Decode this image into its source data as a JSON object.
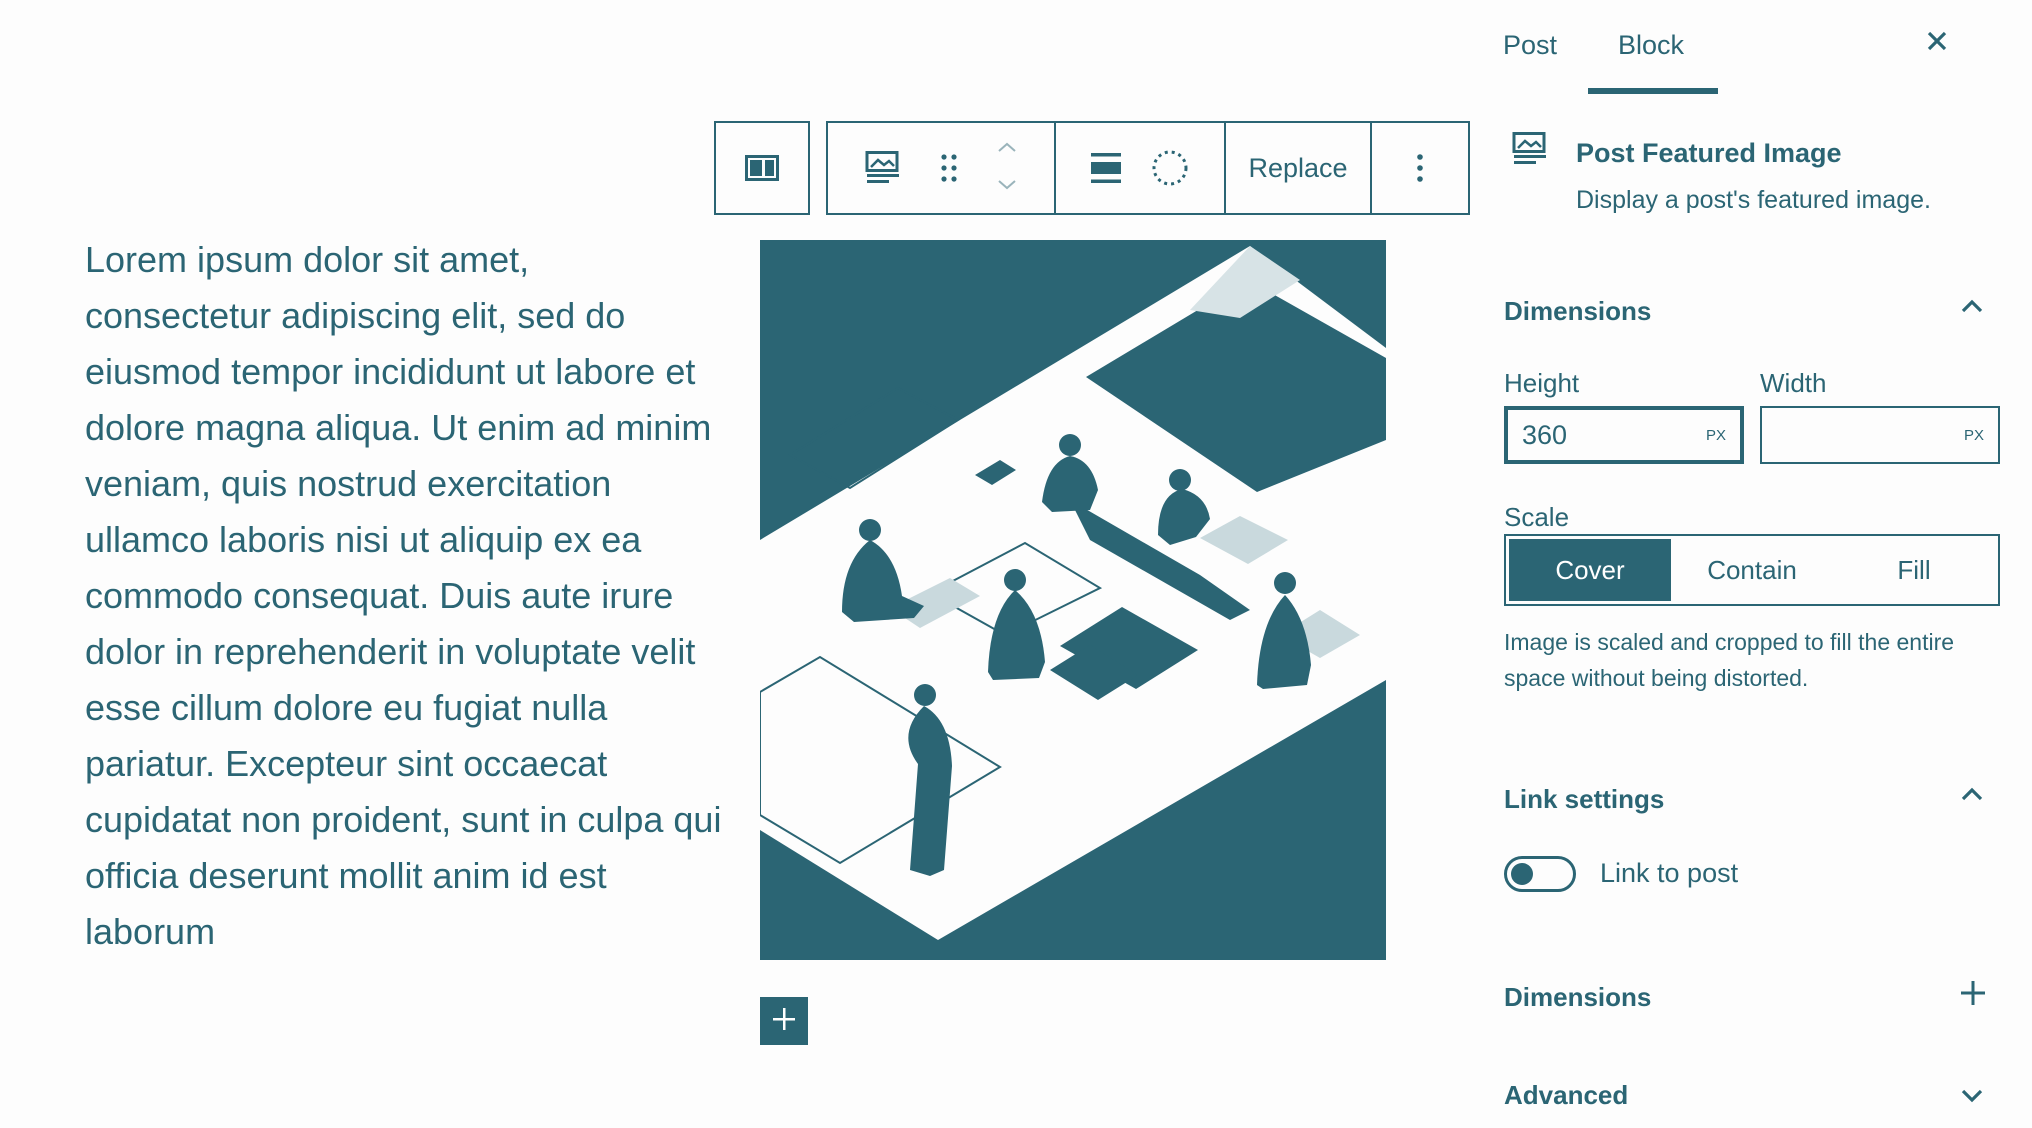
{
  "paragraph": {
    "text": "Lorem ipsum dolor sit amet, consectetur adipiscing elit, sed do eiusmod tempor incididunt ut labore et dolore magna aliqua. Ut enim ad minim veniam, quis nostrud exercitation ullamco laboris nisi ut aliquip ex ea commodo consequat. Duis aute irure dolor in reprehenderit in voluptate velit esse cillum dolore eu fugiat nulla pariatur. Excepteur sint occaecat cupidatat non proident, sunt in culpa qui officia deserunt mollit anim id est laborum"
  },
  "toolbar": {
    "parent_icon": "media-text-icon",
    "block_icon": "post-featured-image-icon",
    "drag_icon": "drag-handle-icon",
    "move_up_icon": "chevron-up-icon",
    "move_down_icon": "chevron-down-icon",
    "align_icon": "align-wide-icon",
    "duotone_icon": "duotone-circle-icon",
    "replace_label": "Replace",
    "more_icon": "more-vertical-icon"
  },
  "sidebar": {
    "tabs": [
      {
        "label": "Post",
        "active": false
      },
      {
        "label": "Block",
        "active": true
      }
    ],
    "close_icon": "close-icon",
    "block_card": {
      "title": "Post Featured Image",
      "description": "Display a post's featured image."
    },
    "dimensions_panel": {
      "title": "Dimensions",
      "height_label": "Height",
      "height_value": "360",
      "height_unit": "PX",
      "width_label": "Width",
      "width_value": "",
      "width_unit": "PX",
      "scale_label": "Scale",
      "scale_options": [
        "Cover",
        "Contain",
        "Fill"
      ],
      "scale_selected": "Cover",
      "scale_help": "Image is scaled and cropped to fill the entire space without being distorted."
    },
    "link_panel": {
      "title": "Link settings",
      "toggle_label": "Link to post",
      "toggle_on": false
    },
    "dimensions_panel_2": {
      "title": "Dimensions"
    },
    "advanced_panel": {
      "title": "Advanced"
    }
  },
  "colors": {
    "accent": "#2b6574",
    "background": "#fdfdfd"
  }
}
